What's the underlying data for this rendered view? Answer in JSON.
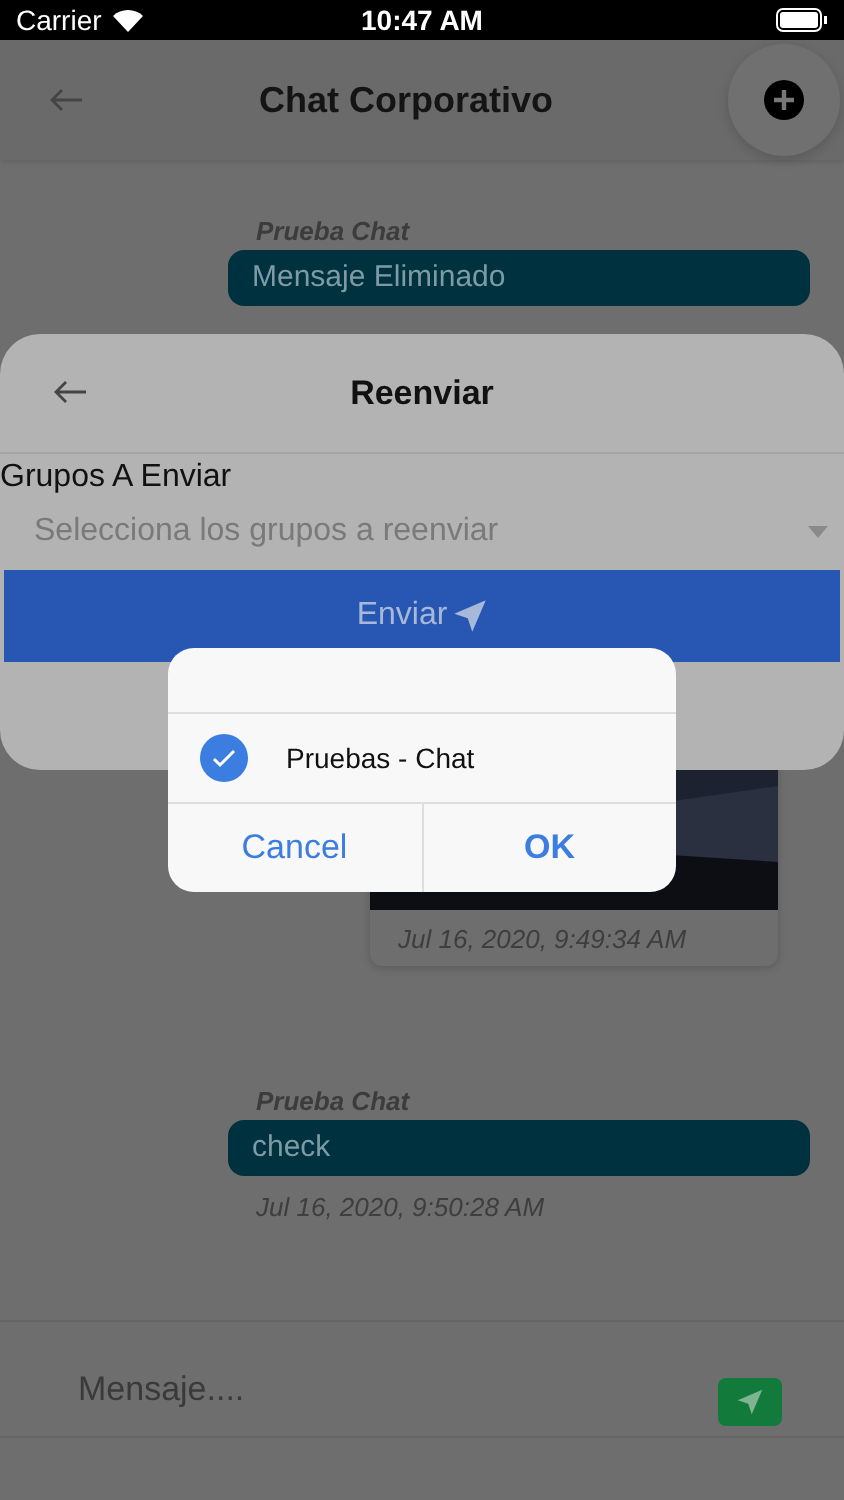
{
  "status_bar": {
    "carrier": "Carrier",
    "time": "10:47 AM"
  },
  "header": {
    "title": "Chat Corporativo"
  },
  "messages": [
    {
      "kind": "text",
      "sender": "Prueba Chat",
      "text": "Mensaje Eliminado"
    },
    {
      "time": "Jul 16, 2020, 9:49:34 AM"
    },
    {
      "kind": "text",
      "sender": "Prueba Chat",
      "text": "check",
      "time": "Jul 16, 2020, 9:50:28 AM"
    }
  ],
  "composer": {
    "placeholder": "Mensaje...."
  },
  "sheet": {
    "title": "Reenviar",
    "label": "Grupos A Enviar",
    "select_placeholder": "Selecciona los grupos a reenviar",
    "button": "Enviar"
  },
  "alert": {
    "options": [
      {
        "label": "Pruebas - Chat",
        "checked": true
      }
    ],
    "buttons": [
      {
        "label": "Cancel",
        "kind": "cancel"
      },
      {
        "label": "OK",
        "kind": "default"
      }
    ]
  }
}
